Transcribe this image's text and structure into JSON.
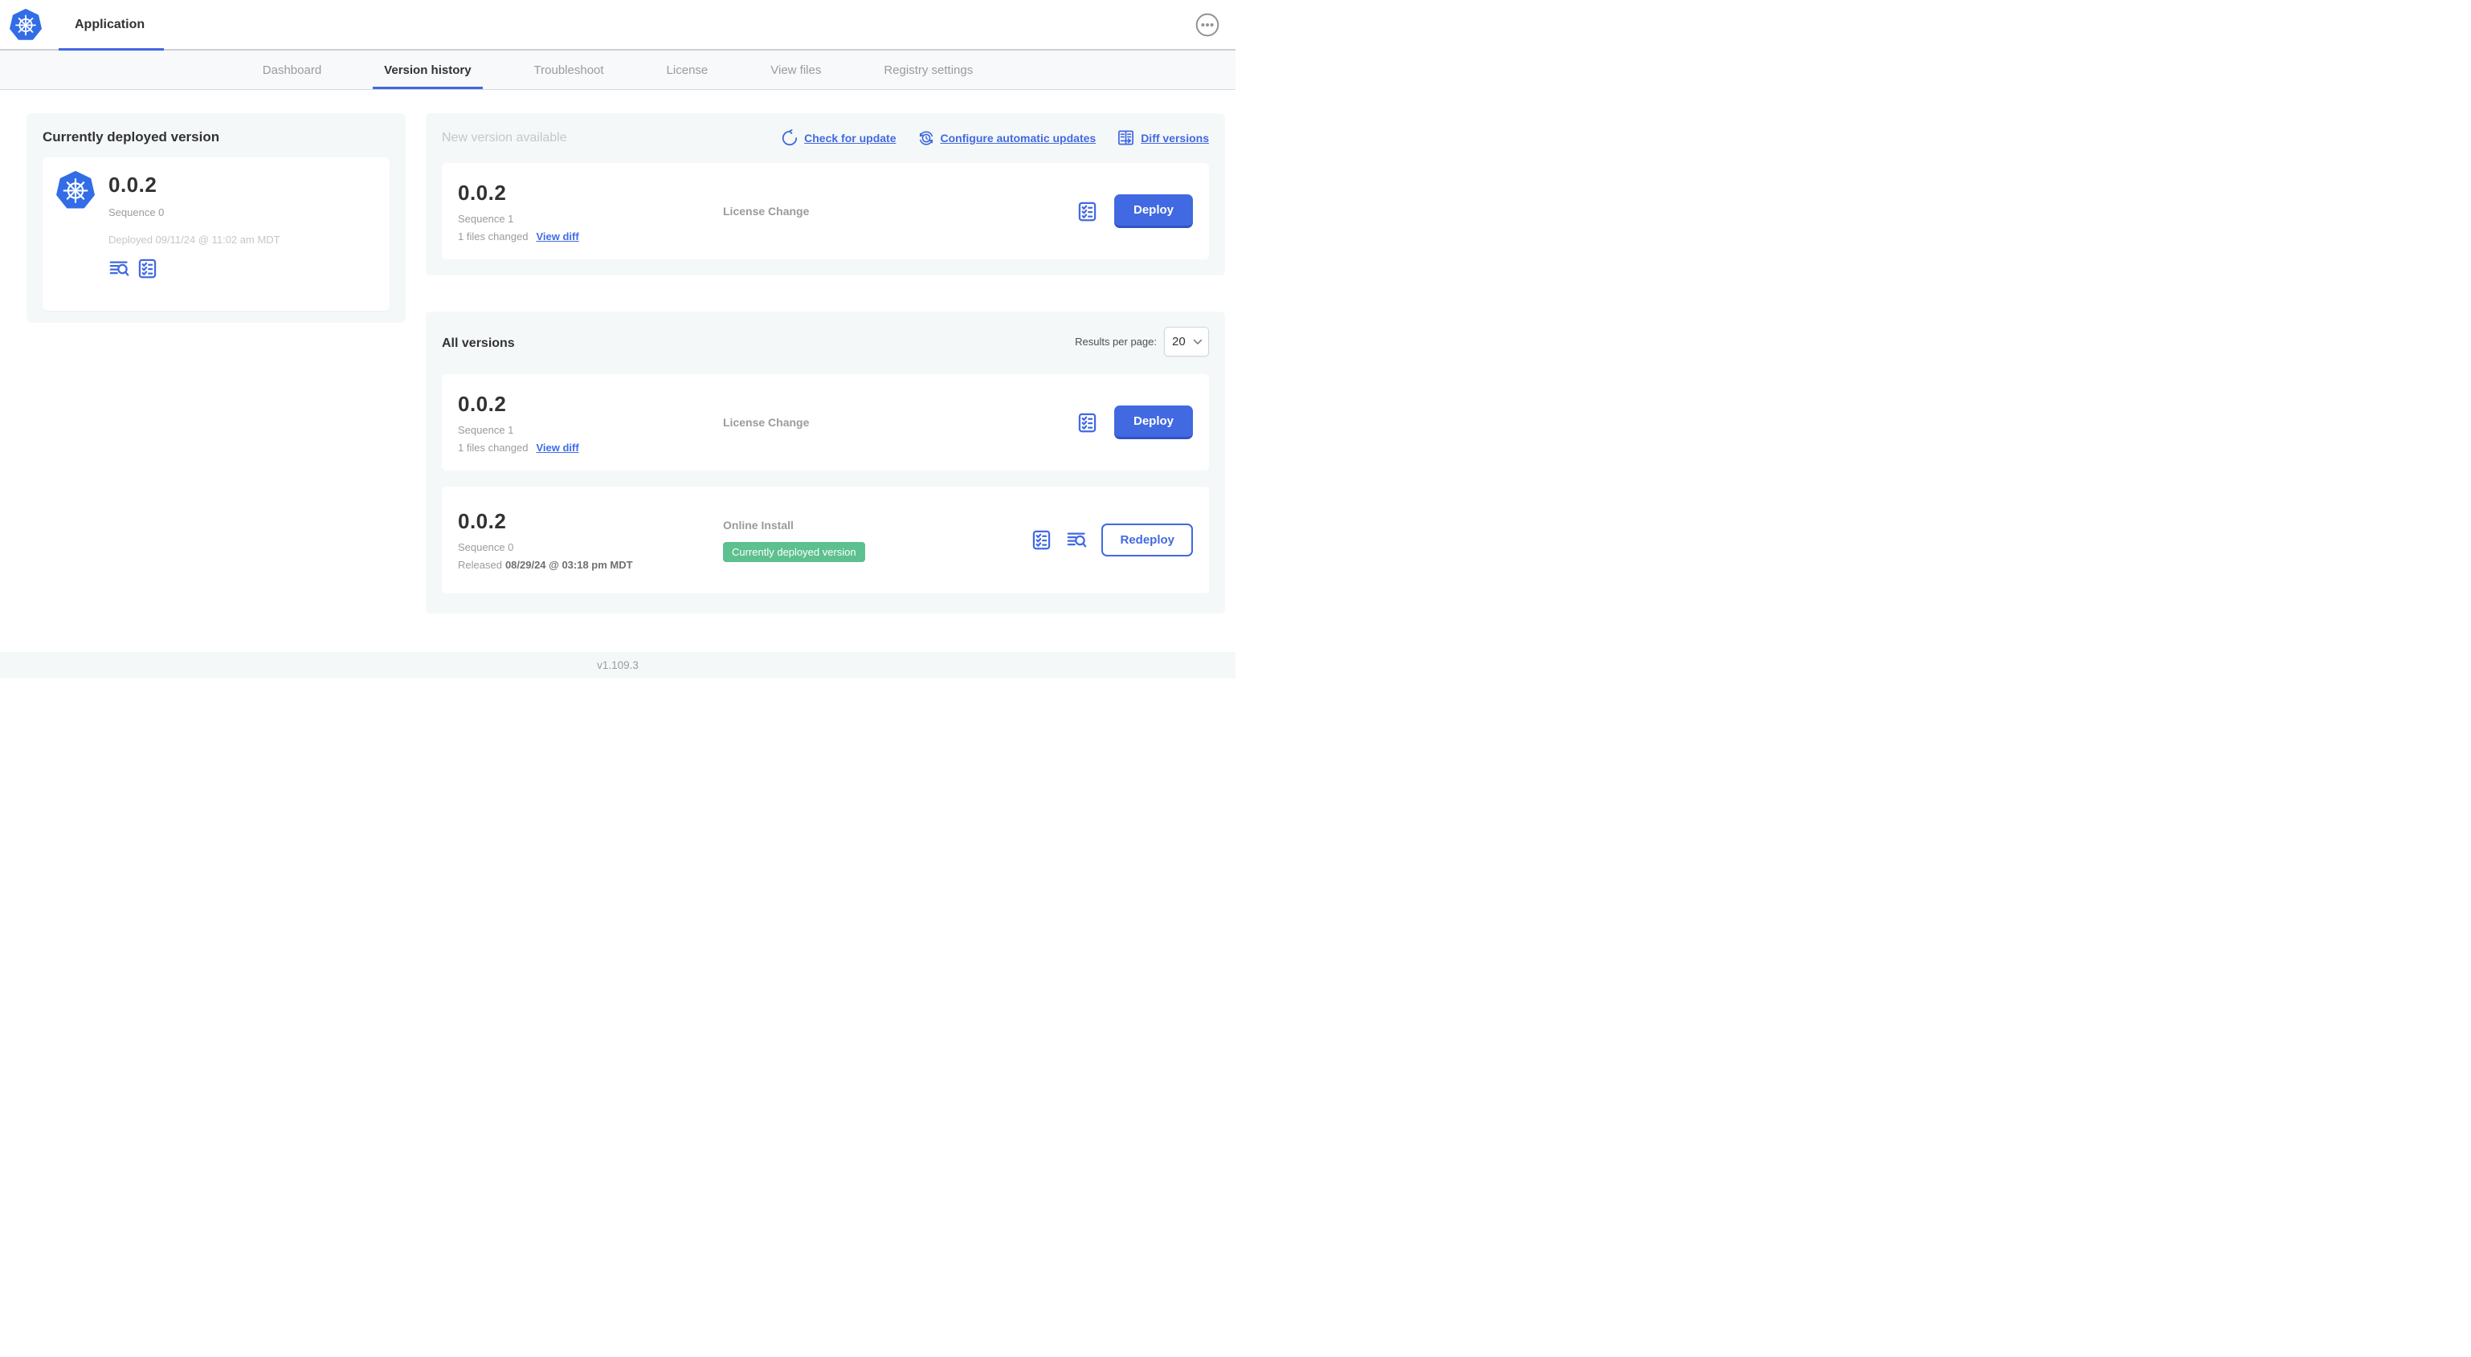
{
  "header": {
    "app_tab": "Application"
  },
  "nav_tabs": [
    "Dashboard",
    "Version history",
    "Troubleshoot",
    "License",
    "View files",
    "Registry settings"
  ],
  "active_tab": "Version history",
  "colors": {
    "primary_blue": "#4169e1",
    "logo_blue": "#326de6",
    "badge_green": "#5cc08f"
  },
  "current_deployed": {
    "title": "Currently deployed version",
    "version": "0.0.2",
    "sequence": "Sequence 0",
    "deployed": "Deployed 09/11/24 @ 11:02 am MDT"
  },
  "new_version": {
    "title": "New version available",
    "links": {
      "check": "Check for update",
      "configure": "Configure automatic updates",
      "diff": "Diff versions"
    },
    "row": {
      "version": "0.0.2",
      "sequence": "Sequence 1",
      "files_changed": "1 files changed",
      "view_diff": "View diff",
      "source": "License Change",
      "action_label": "Deploy"
    }
  },
  "all_versions": {
    "title": "All versions",
    "results_per_page_label": "Results per page:",
    "results_per_page_value": "20",
    "rows": [
      {
        "version": "0.0.2",
        "sequence": "Sequence 1",
        "files_changed": "1 files changed",
        "view_diff": "View diff",
        "source": "License Change",
        "action_label": "Deploy"
      },
      {
        "version": "0.0.2",
        "sequence": "Sequence 0",
        "released_prefix": "Released",
        "released_date": "08/29/24 @ 03:18 pm MDT",
        "source": "Online Install",
        "badge": "Currently deployed version",
        "action_label": "Redeploy"
      }
    ]
  },
  "footer": {
    "version": "v1.109.3"
  }
}
